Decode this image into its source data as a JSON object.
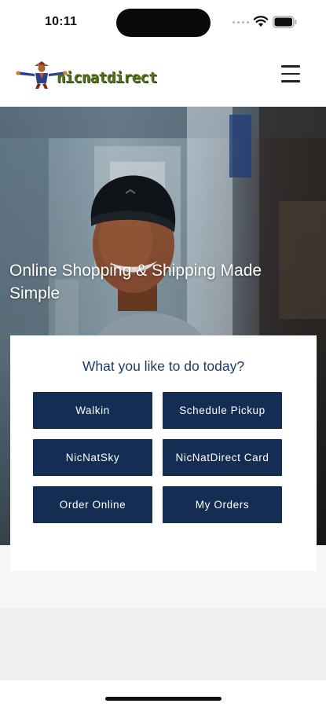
{
  "status_bar": {
    "time": "10:11"
  },
  "header": {
    "brand_name": "nicnatdirect",
    "brand_color": "#55701a",
    "menu_icon": "hamburger-menu-icon"
  },
  "hero": {
    "title": "Online Shopping & Shipping Made Simple"
  },
  "actions": {
    "heading": "What you like to do today?",
    "heading_color": "#173c6a",
    "button_color": "#142d52",
    "buttons": [
      {
        "label": "Walkin"
      },
      {
        "label": "Schedule Pickup"
      },
      {
        "label": "NicNatSky"
      },
      {
        "label": "NicNatDirect Card"
      },
      {
        "label": "Order Online"
      },
      {
        "label": "My Orders"
      }
    ]
  }
}
